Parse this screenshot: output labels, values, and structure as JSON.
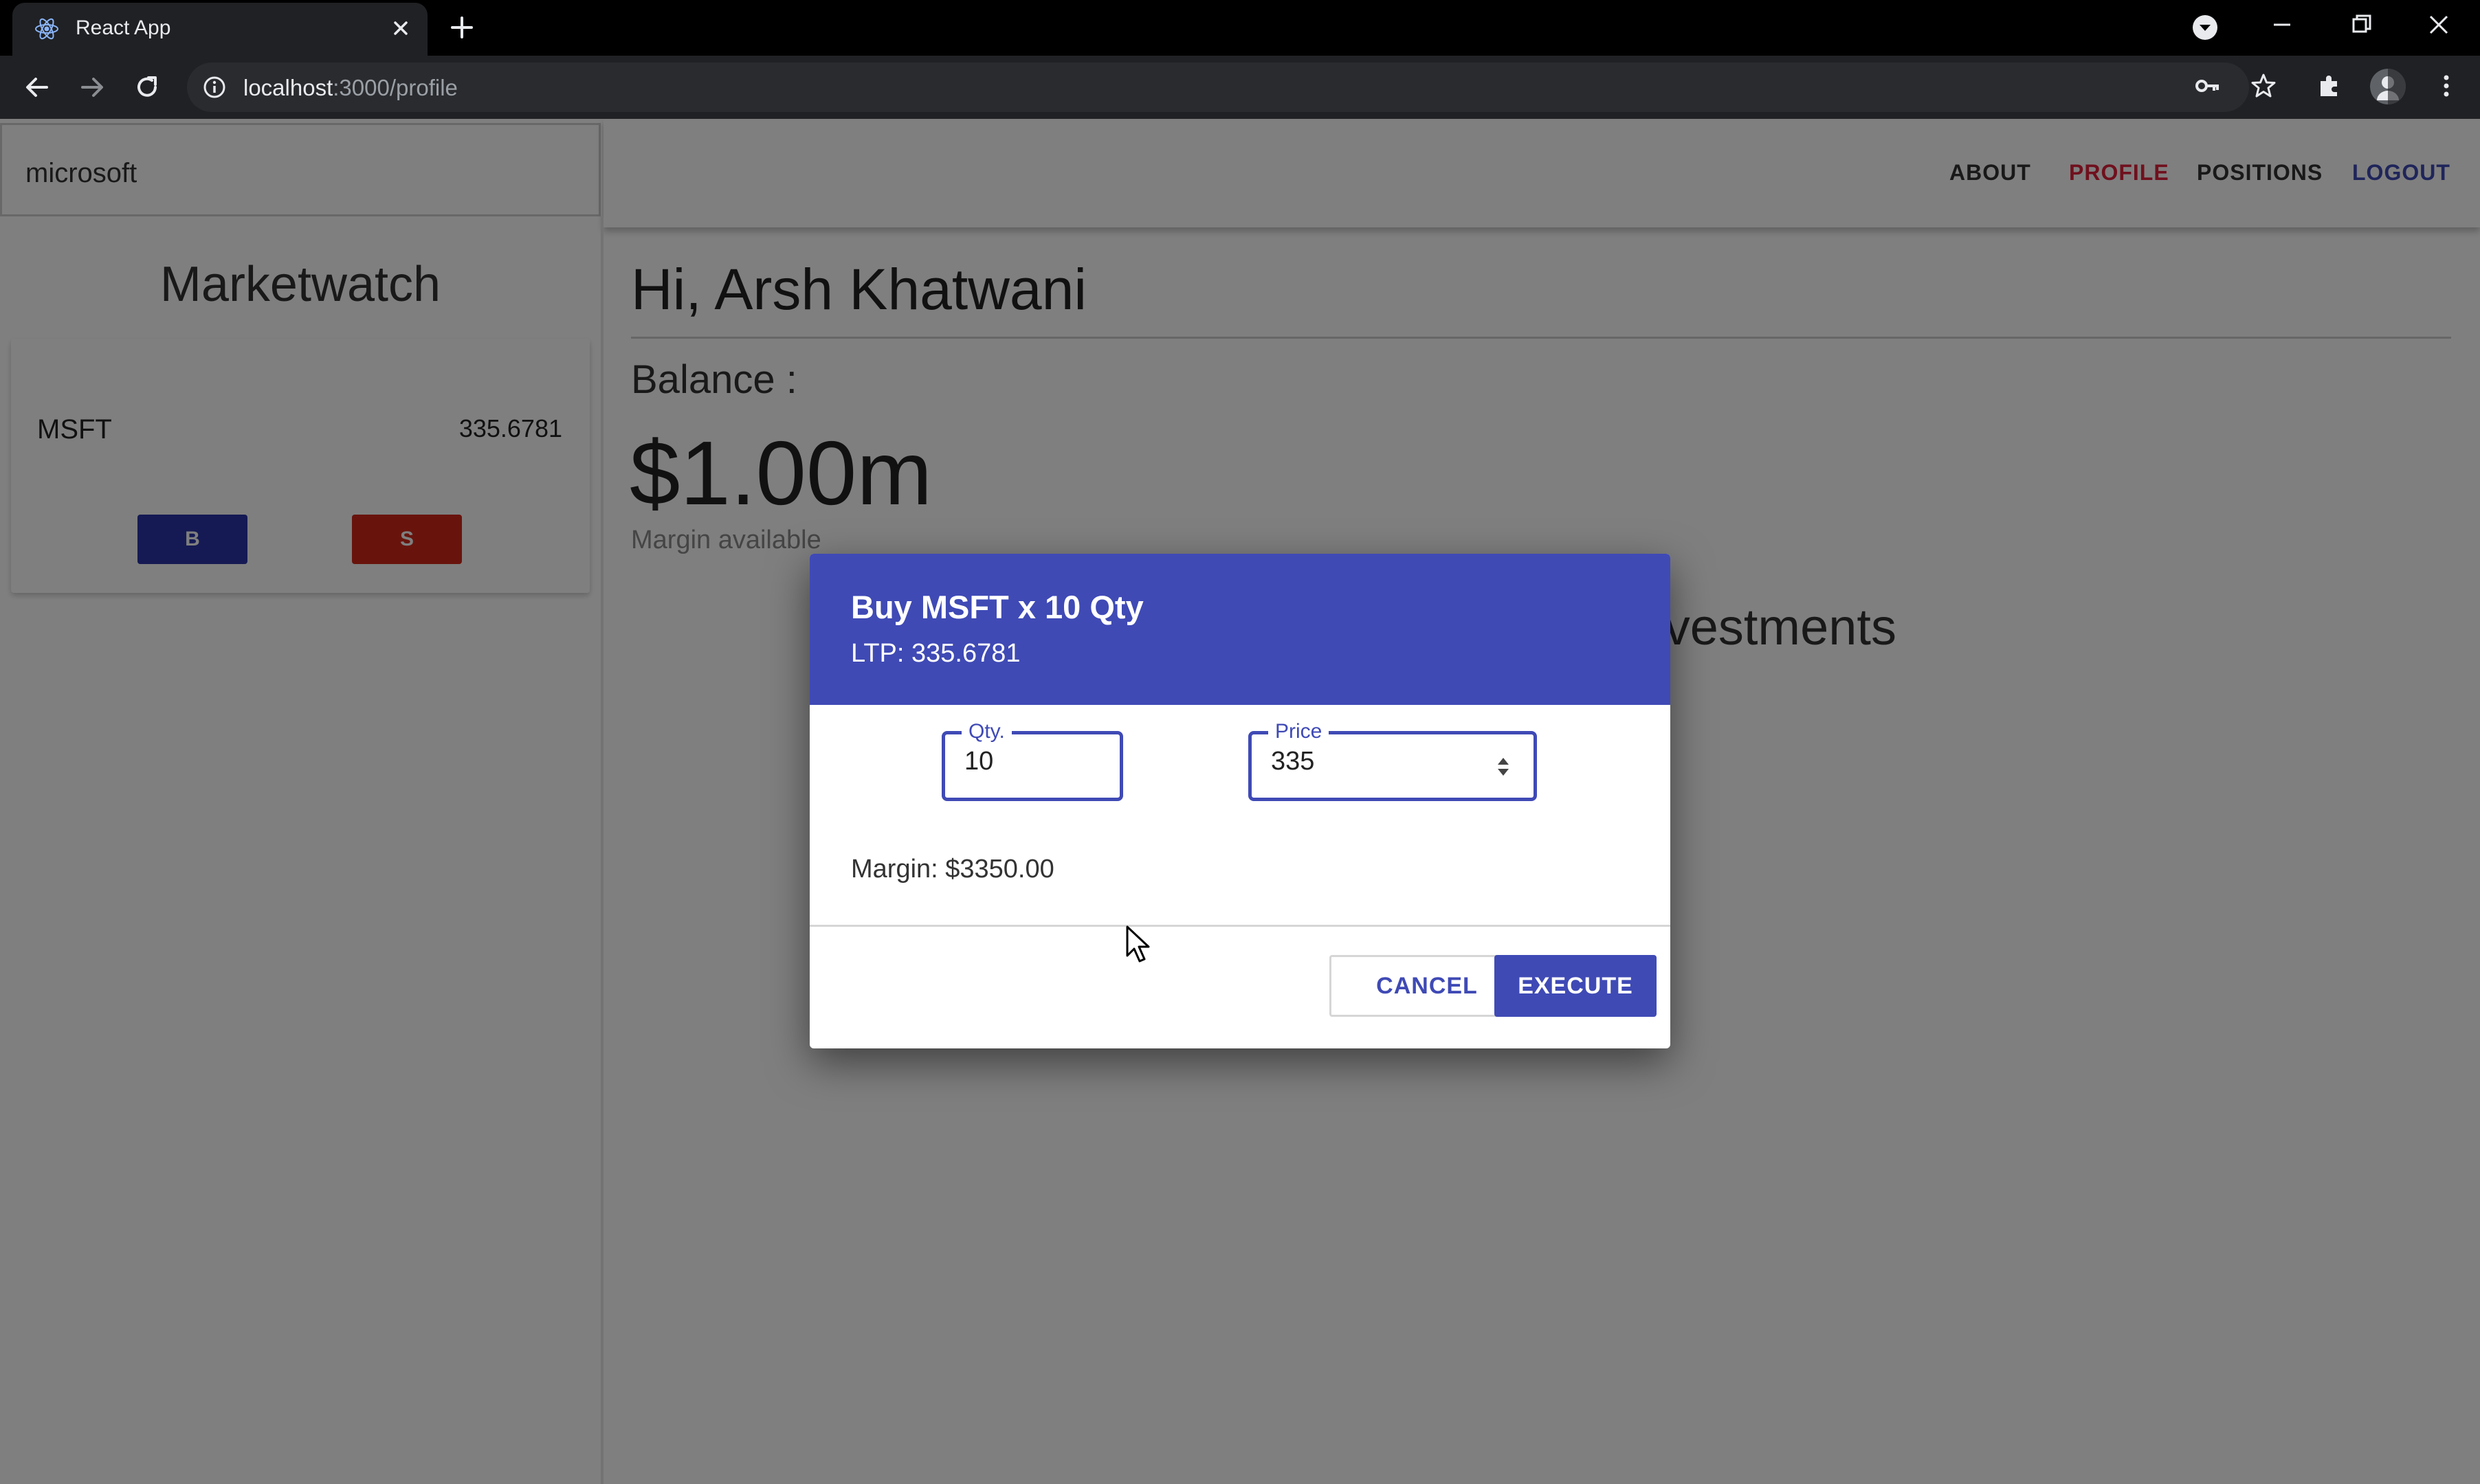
{
  "browser": {
    "tab_title": "React App",
    "url_host": "localhost",
    "url_path": ":3000/profile"
  },
  "sidebar": {
    "search_value": "microsoft",
    "title": "Marketwatch",
    "tickers": [
      {
        "symbol": "MSFT",
        "price": "335.6781",
        "buy_label": "B",
        "sell_label": "S"
      }
    ]
  },
  "nav": {
    "links": [
      {
        "label": "ABOUT",
        "color": "#333333"
      },
      {
        "label": "PROFILE",
        "color": "#e0203a"
      },
      {
        "label": "POSITIONS",
        "color": "#333333"
      },
      {
        "label": "LOGOUT",
        "color": "#3f4ab5"
      }
    ]
  },
  "profile": {
    "greeting": "Hi, Arsh Khatwani",
    "balance_label": "Balance :",
    "balance_value": "$1.00m",
    "margin_label": "Margin available",
    "investments_heading": "Investments"
  },
  "dialog": {
    "title": "Buy MSFT x 10 Qty",
    "ltp": "LTP: 335.6781",
    "qty_label": "Qty.",
    "qty_value": "10",
    "price_label": "Price",
    "price_value": "335",
    "margin_text": "Margin: $3350.00",
    "cancel_label": "CANCEL",
    "execute_label": "EXECUTE"
  },
  "colors": {
    "primary": "#3f4ab5",
    "buy": "#2a35a8",
    "sell": "#d0281b",
    "active_link": "#e0203a"
  }
}
